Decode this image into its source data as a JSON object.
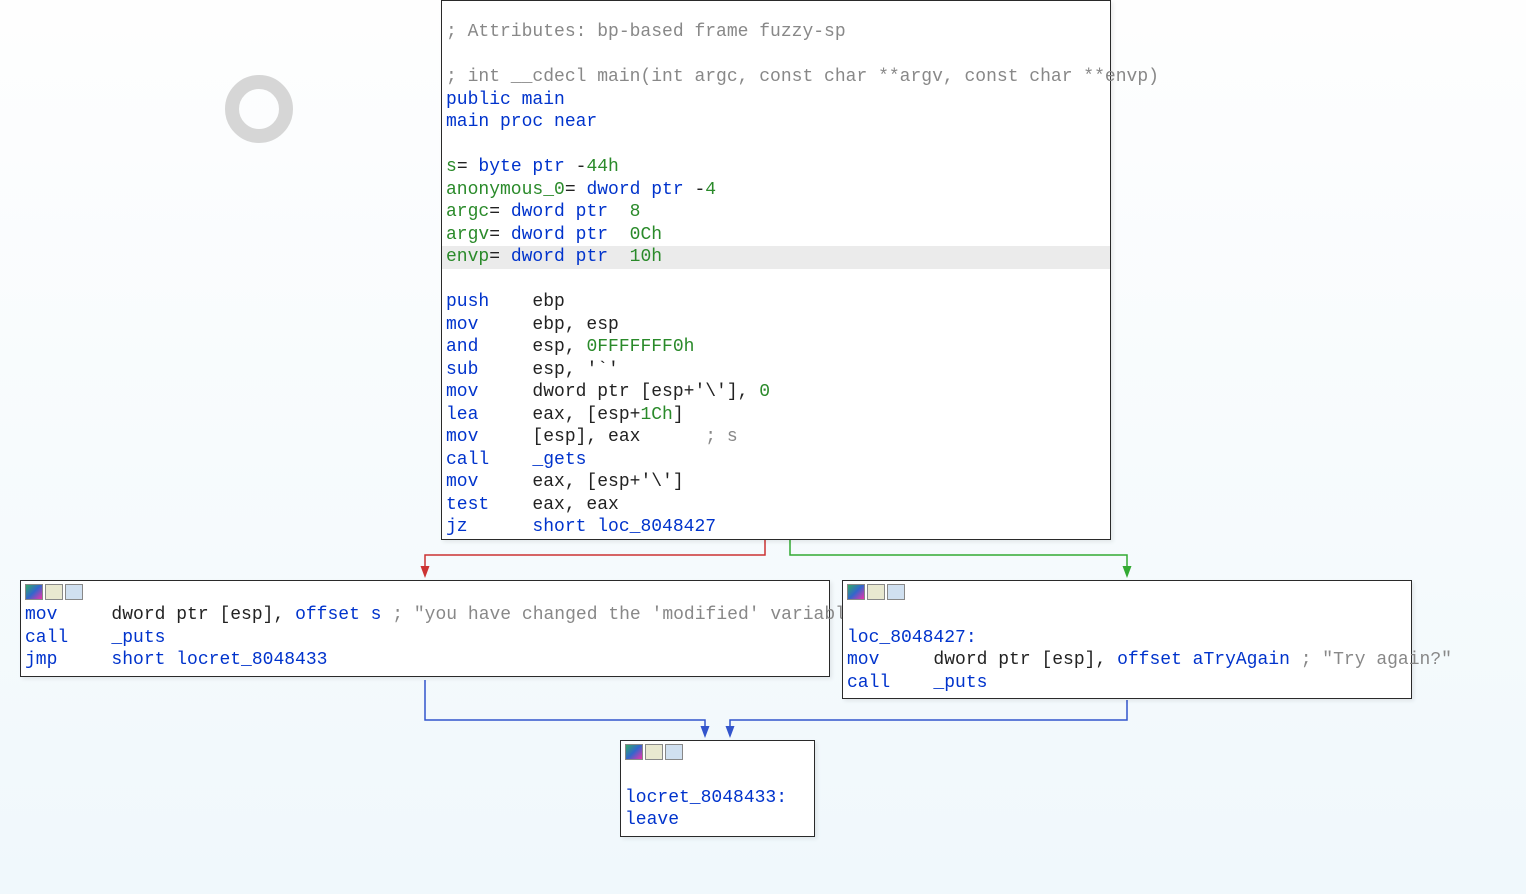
{
  "main_block": {
    "attr_comment": "; Attributes: bp-based frame fuzzy-sp",
    "sig_comment": "; int __cdecl main(int argc, const char **argv, const char **envp)",
    "public_line": "public main",
    "proc_line": "main proc near",
    "vars": {
      "s": "s= byte ptr -44h",
      "anon": "anonymous_0= dword ptr -4",
      "argc": "argc= dword ptr  8",
      "argv": "argv= dword ptr  0Ch",
      "envp": "envp= dword ptr  10h"
    },
    "instr": {
      "l1": {
        "op": "push",
        "args": "ebp"
      },
      "l2": {
        "op": "mov",
        "args": "ebp, esp"
      },
      "l3": {
        "op": "and",
        "args_pre": "esp, ",
        "imm": "0FFFFFFF0h"
      },
      "l4": {
        "op": "sub",
        "args_pre": "esp, ",
        "imm": "'`'"
      },
      "l5": {
        "op": "mov",
        "args_pre": "dword ptr [esp+",
        "imm1": "'\\'",
        "args_mid": "], ",
        "imm2": "0"
      },
      "l6": {
        "op": "lea",
        "args_pre": "eax, [esp+",
        "imm": "1Ch",
        "args_post": "]"
      },
      "l7": {
        "op": "mov",
        "args": "[esp], eax",
        "cmt": "      ; s"
      },
      "l8": {
        "op": "call",
        "target": "_gets"
      },
      "l9": {
        "op": "mov",
        "args_pre": "eax, [esp+",
        "imm": "'\\'",
        "args_post": "]"
      },
      "l10": {
        "op": "test",
        "args": "eax, eax"
      },
      "l11": {
        "op": "jz",
        "args_pre": "short ",
        "target": "loc_8048427"
      }
    }
  },
  "left_block": {
    "l1": {
      "op": "mov",
      "args_pre": "dword ptr [esp], ",
      "kw": "offset",
      "ref": " s ",
      "cmt": "; \"you have changed the 'modified' variabl\"..."
    },
    "l2": {
      "op": "call",
      "target": "_puts"
    },
    "l3": {
      "op": "jmp",
      "args_pre": "short ",
      "target": "locret_8048433"
    }
  },
  "right_block": {
    "label": "loc_8048427:",
    "l1": {
      "op": "mov",
      "args_pre": "dword ptr [esp], ",
      "kw": "offset",
      "ref": " aTryAgain ",
      "cmt": "; \"Try again?\""
    },
    "l2": {
      "op": "call",
      "target": "_puts"
    }
  },
  "bottom_block": {
    "label": "locret_8048433:",
    "l1": {
      "op": "leave"
    }
  }
}
